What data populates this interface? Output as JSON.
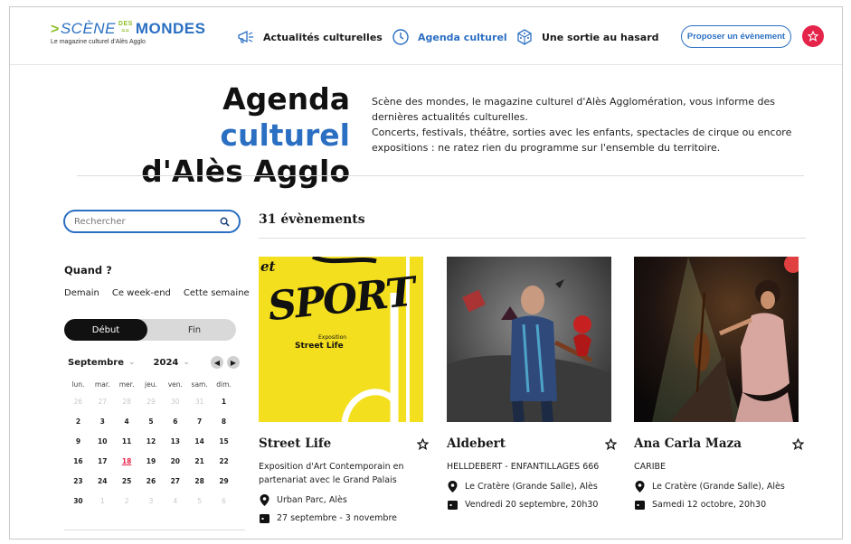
{
  "header": {
    "logo_scene": "SCÈNE",
    "logo_des": "DES",
    "logo_mondes": "MONDES",
    "logo_sub": "Le magazine culturel d'Alès Agglo",
    "nav": [
      {
        "label": "Actualités culturelles",
        "icon": "megaphone-icon"
      },
      {
        "label": "Agenda culturel",
        "icon": "clock-icon"
      },
      {
        "label": "Une sortie au hasard",
        "icon": "dice-icon"
      }
    ],
    "propose_label": "Proposer un évènement",
    "fav_icon": "star-icon"
  },
  "hero": {
    "title_part1": "Agenda ",
    "title_part2": "culturel",
    "title_line2": "d'Alès Agglo",
    "text_p1": "Scène des mondes, le magazine culturel d'Alès Agglomération, vous informe des dernières actualités culturelles.",
    "text_p2": "Concerts, festivals, théâtre, sorties avec les enfants, spectacles de cirque ou encore expositions : ne ratez rien du programme sur l'ensemble du territoire."
  },
  "sidebar": {
    "search_placeholder": "Rechercher",
    "quand_label": "Quand ?",
    "quick_options": [
      "Demain",
      "Ce week-end",
      "Cette semaine"
    ],
    "seg_start": "Début",
    "seg_end": "Fin",
    "month": "Septembre",
    "year": "2024",
    "weekdays": [
      "lun.",
      "mar.",
      "mer.",
      "jeu.",
      "ven.",
      "sam.",
      "dim."
    ],
    "weeks": [
      [
        {
          "d": "26",
          "m": true
        },
        {
          "d": "27",
          "m": true
        },
        {
          "d": "28",
          "m": true
        },
        {
          "d": "29",
          "m": true
        },
        {
          "d": "30",
          "m": true
        },
        {
          "d": "31",
          "m": true
        },
        {
          "d": "1"
        }
      ],
      [
        {
          "d": "2"
        },
        {
          "d": "3"
        },
        {
          "d": "4"
        },
        {
          "d": "5"
        },
        {
          "d": "6"
        },
        {
          "d": "7"
        },
        {
          "d": "8"
        }
      ],
      [
        {
          "d": "9"
        },
        {
          "d": "10"
        },
        {
          "d": "11"
        },
        {
          "d": "12"
        },
        {
          "d": "13"
        },
        {
          "d": "14"
        },
        {
          "d": "15"
        }
      ],
      [
        {
          "d": "16"
        },
        {
          "d": "17"
        },
        {
          "d": "18",
          "t": true
        },
        {
          "d": "19"
        },
        {
          "d": "20"
        },
        {
          "d": "21"
        },
        {
          "d": "22"
        }
      ],
      [
        {
          "d": "23"
        },
        {
          "d": "24"
        },
        {
          "d": "25"
        },
        {
          "d": "26"
        },
        {
          "d": "27"
        },
        {
          "d": "28"
        },
        {
          "d": "29"
        }
      ],
      [
        {
          "d": "30"
        },
        {
          "d": "1",
          "m": true
        },
        {
          "d": "2",
          "m": true
        },
        {
          "d": "3",
          "m": true
        },
        {
          "d": "4",
          "m": true
        },
        {
          "d": "5",
          "m": true
        },
        {
          "d": "6",
          "m": true
        }
      ]
    ]
  },
  "results": {
    "count_label": "31 évènements",
    "events": [
      {
        "title": "Street Life",
        "subtitle": "Exposition d'Art Contemporain en partenariat avec le Grand Palais",
        "location": "Urban Parc, Alès",
        "date": "27 septembre - 3 novembre",
        "poster_lines": [
          "et",
          "SPORT",
          "Exposition",
          "Street Life"
        ]
      },
      {
        "title": "Aldebert",
        "subtitle": "HELLDEBERT - ENFANTILLAGES 666",
        "location": "Le Cratère (Grande Salle), Alès",
        "date": "Vendredi 20 septembre, 20h30"
      },
      {
        "title": "Ana Carla Maza",
        "subtitle": "CARIBE",
        "location": "Le Cratère (Grande Salle), Alès",
        "date": "Samedi 12 octobre, 20h30"
      }
    ]
  },
  "colors": {
    "brand_blue": "#2b6fc2",
    "brand_green": "#8cbf26",
    "accent_red": "#e5244a"
  }
}
